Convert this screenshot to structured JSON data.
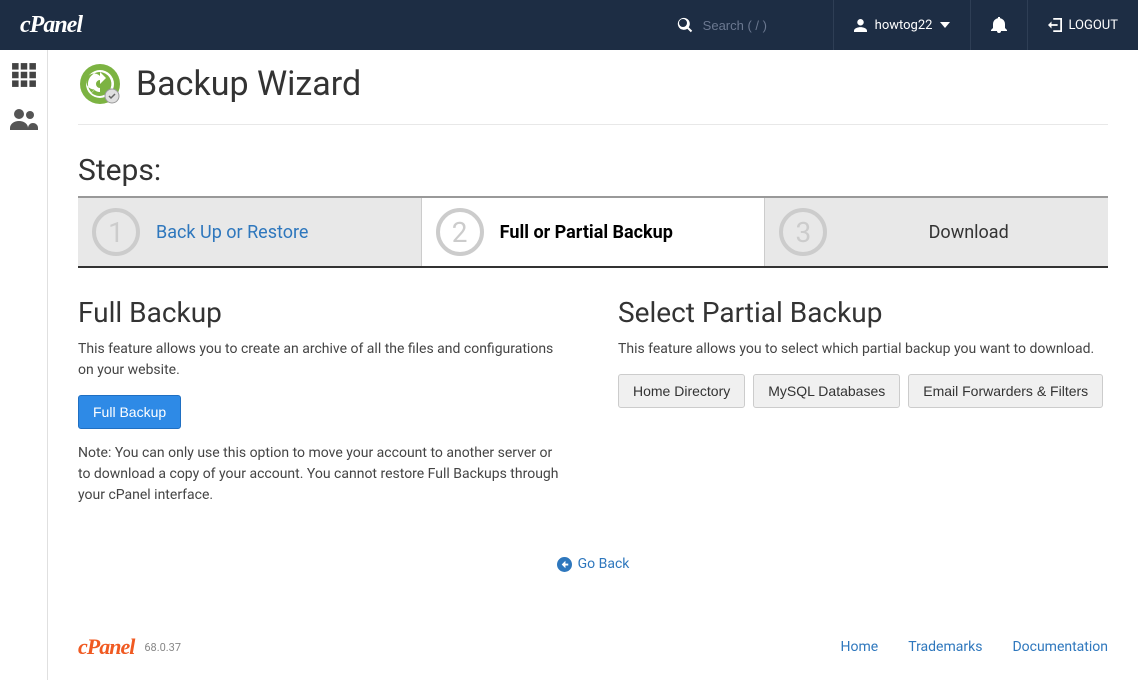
{
  "header": {
    "brand": "cPanel",
    "search_placeholder": "Search ( / )",
    "username": "howtog22",
    "logout": "LOGOUT"
  },
  "page": {
    "title": "Backup Wizard",
    "steps_label": "Steps:",
    "steps": [
      {
        "num": "1",
        "label": "Back Up or Restore"
      },
      {
        "num": "2",
        "label": "Full or Partial Backup"
      },
      {
        "num": "3",
        "label": "Download"
      }
    ]
  },
  "full_backup": {
    "heading": "Full Backup",
    "desc": "This feature allows you to create an archive of all the files and configurations on your website.",
    "button": "Full Backup",
    "note": "Note: You can only use this option to move your account to another server or to download a copy of your account. You cannot restore Full Backups through your cPanel interface."
  },
  "partial_backup": {
    "heading": "Select Partial Backup",
    "desc": "This feature allows you to select which partial backup you want to download.",
    "buttons": [
      "Home Directory",
      "MySQL Databases",
      "Email Forwarders & Filters"
    ]
  },
  "goback": "Go Back",
  "footer": {
    "brand": "cPanel",
    "version": "68.0.37",
    "links": [
      "Home",
      "Trademarks",
      "Documentation"
    ]
  }
}
